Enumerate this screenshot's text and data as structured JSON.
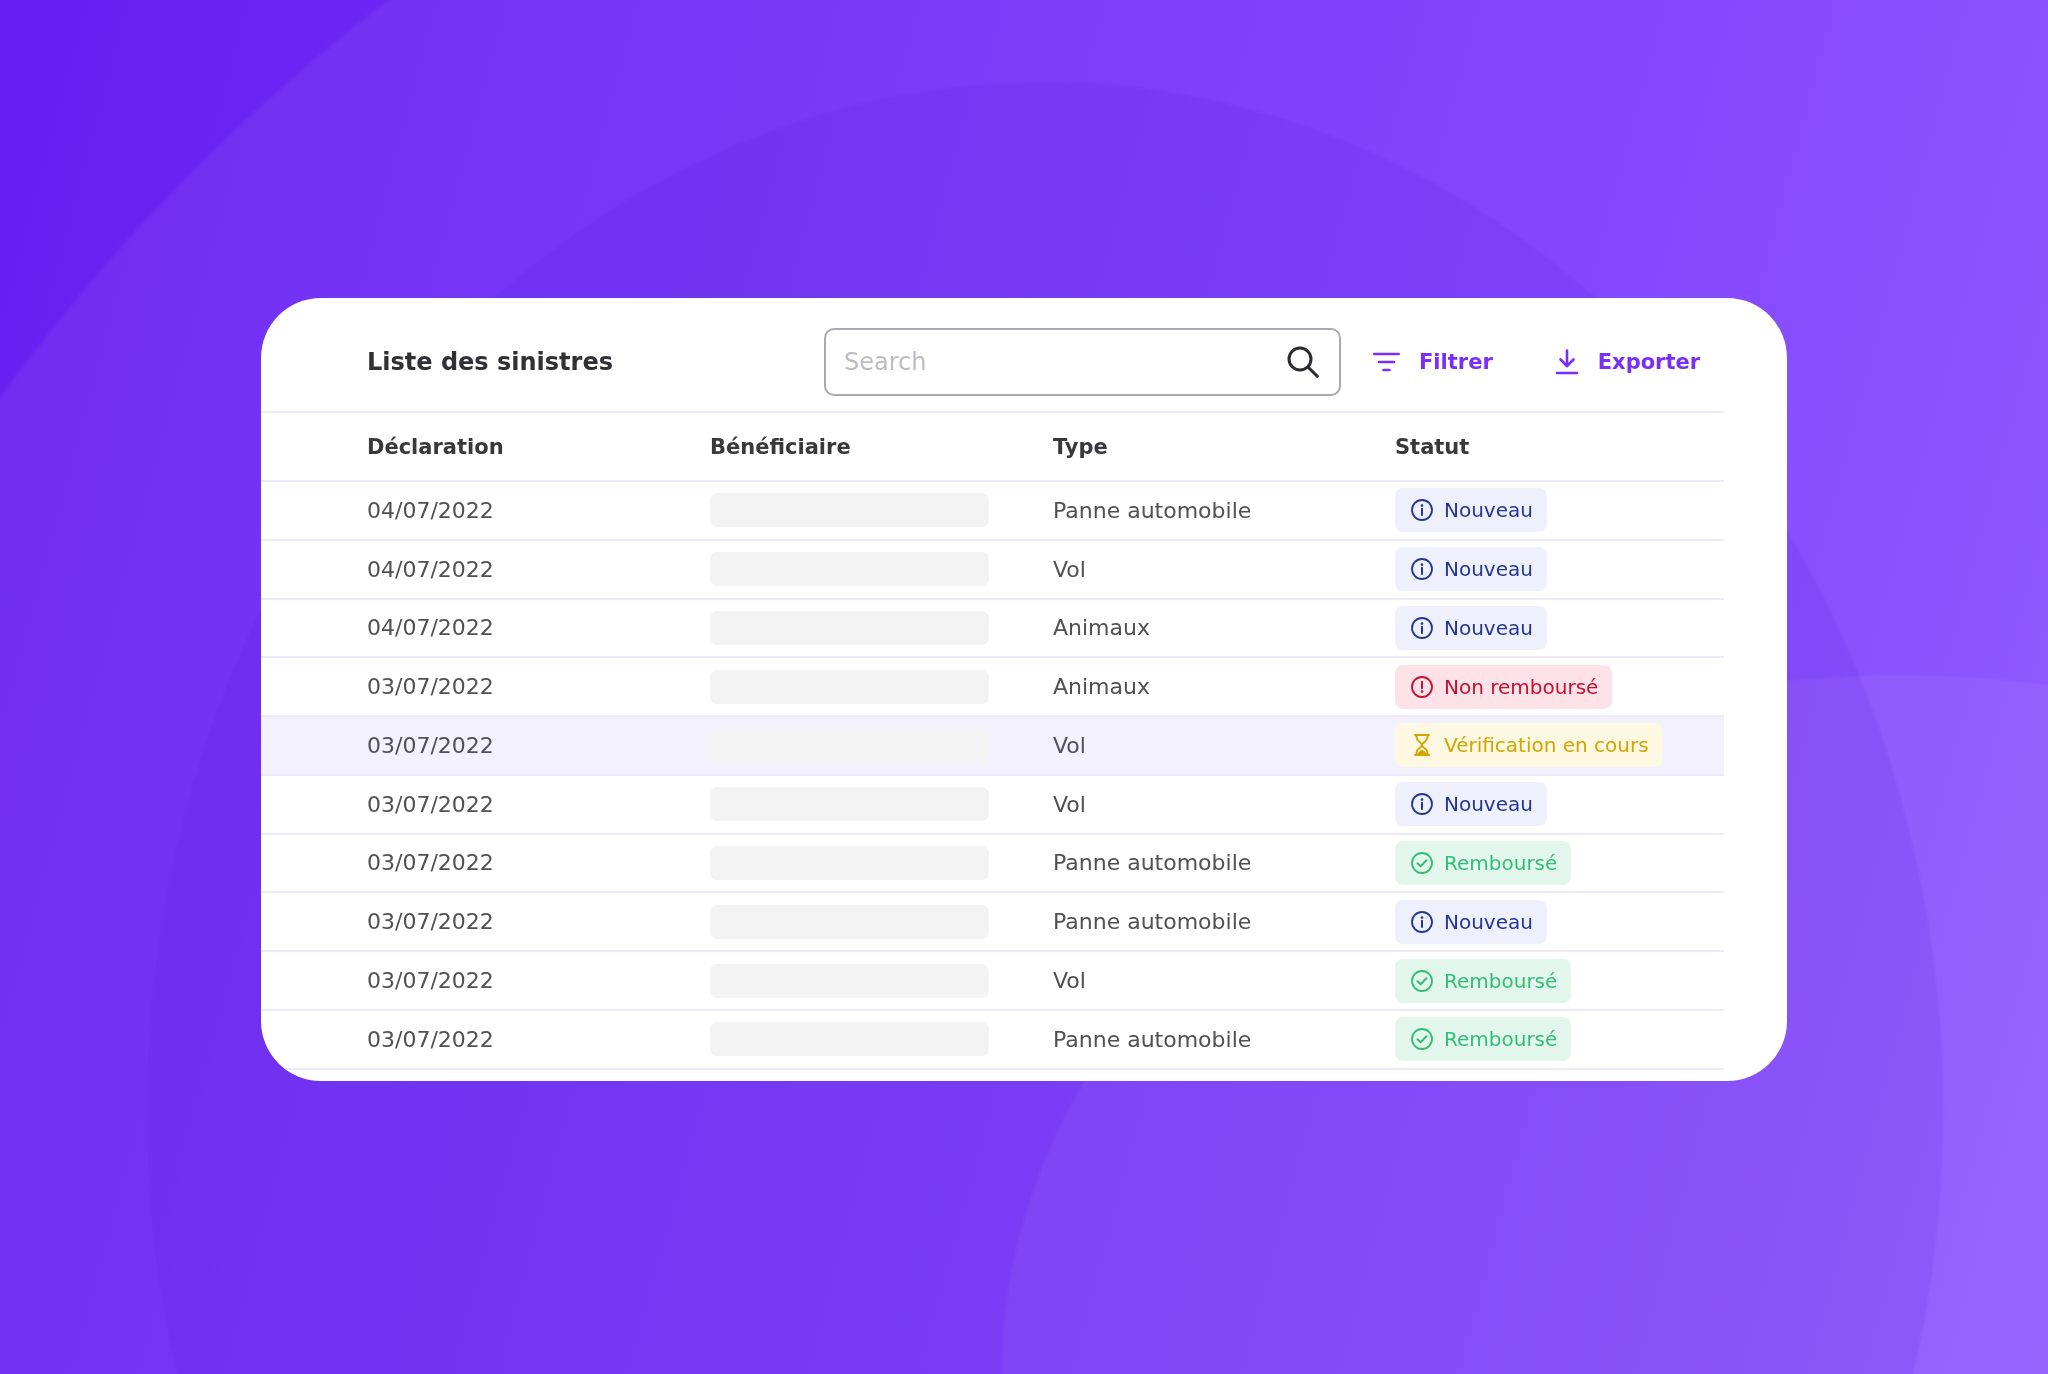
{
  "header": {
    "title": "Liste des sinistres",
    "search": {
      "placeholder": "Search"
    },
    "actions": [
      {
        "label": "Filtrer",
        "kind": "filter"
      },
      {
        "label": "Exporter",
        "kind": "export"
      }
    ]
  },
  "table": {
    "columns": [
      "Déclaration",
      "Bénéficiaire",
      "Type",
      "Statut"
    ],
    "rows": [
      {
        "date": "04/07/2022",
        "beneficiary_hidden": true,
        "type": "Panne automobile",
        "status": {
          "label": "Nouveau",
          "kind": "new"
        },
        "selected": false
      },
      {
        "date": "04/07/2022",
        "beneficiary_hidden": true,
        "type": "Vol",
        "status": {
          "label": "Nouveau",
          "kind": "new"
        },
        "selected": false
      },
      {
        "date": "04/07/2022",
        "beneficiary_hidden": true,
        "type": "Animaux",
        "status": {
          "label": "Nouveau",
          "kind": "new"
        },
        "selected": false
      },
      {
        "date": "03/07/2022",
        "beneficiary_hidden": true,
        "type": "Animaux",
        "status": {
          "label": "Non remboursé",
          "kind": "refused"
        },
        "selected": false
      },
      {
        "date": "03/07/2022",
        "beneficiary_hidden": true,
        "type": "Vol",
        "status": {
          "label": "Vérification en cours",
          "kind": "pending"
        },
        "selected": true
      },
      {
        "date": "03/07/2022",
        "beneficiary_hidden": true,
        "type": "Vol",
        "status": {
          "label": "Nouveau",
          "kind": "new"
        },
        "selected": false
      },
      {
        "date": "03/07/2022",
        "beneficiary_hidden": true,
        "type": "Panne automobile",
        "status": {
          "label": "Remboursé",
          "kind": "refunded"
        },
        "selected": false
      },
      {
        "date": "03/07/2022",
        "beneficiary_hidden": true,
        "type": "Panne automobile",
        "status": {
          "label": "Nouveau",
          "kind": "new"
        },
        "selected": false
      },
      {
        "date": "03/07/2022",
        "beneficiary_hidden": true,
        "type": "Vol",
        "status": {
          "label": "Remboursé",
          "kind": "refunded"
        },
        "selected": false
      },
      {
        "date": "03/07/2022",
        "beneficiary_hidden": true,
        "type": "Panne automobile",
        "status": {
          "label": "Remboursé",
          "kind": "refunded"
        },
        "selected": false
      }
    ]
  }
}
